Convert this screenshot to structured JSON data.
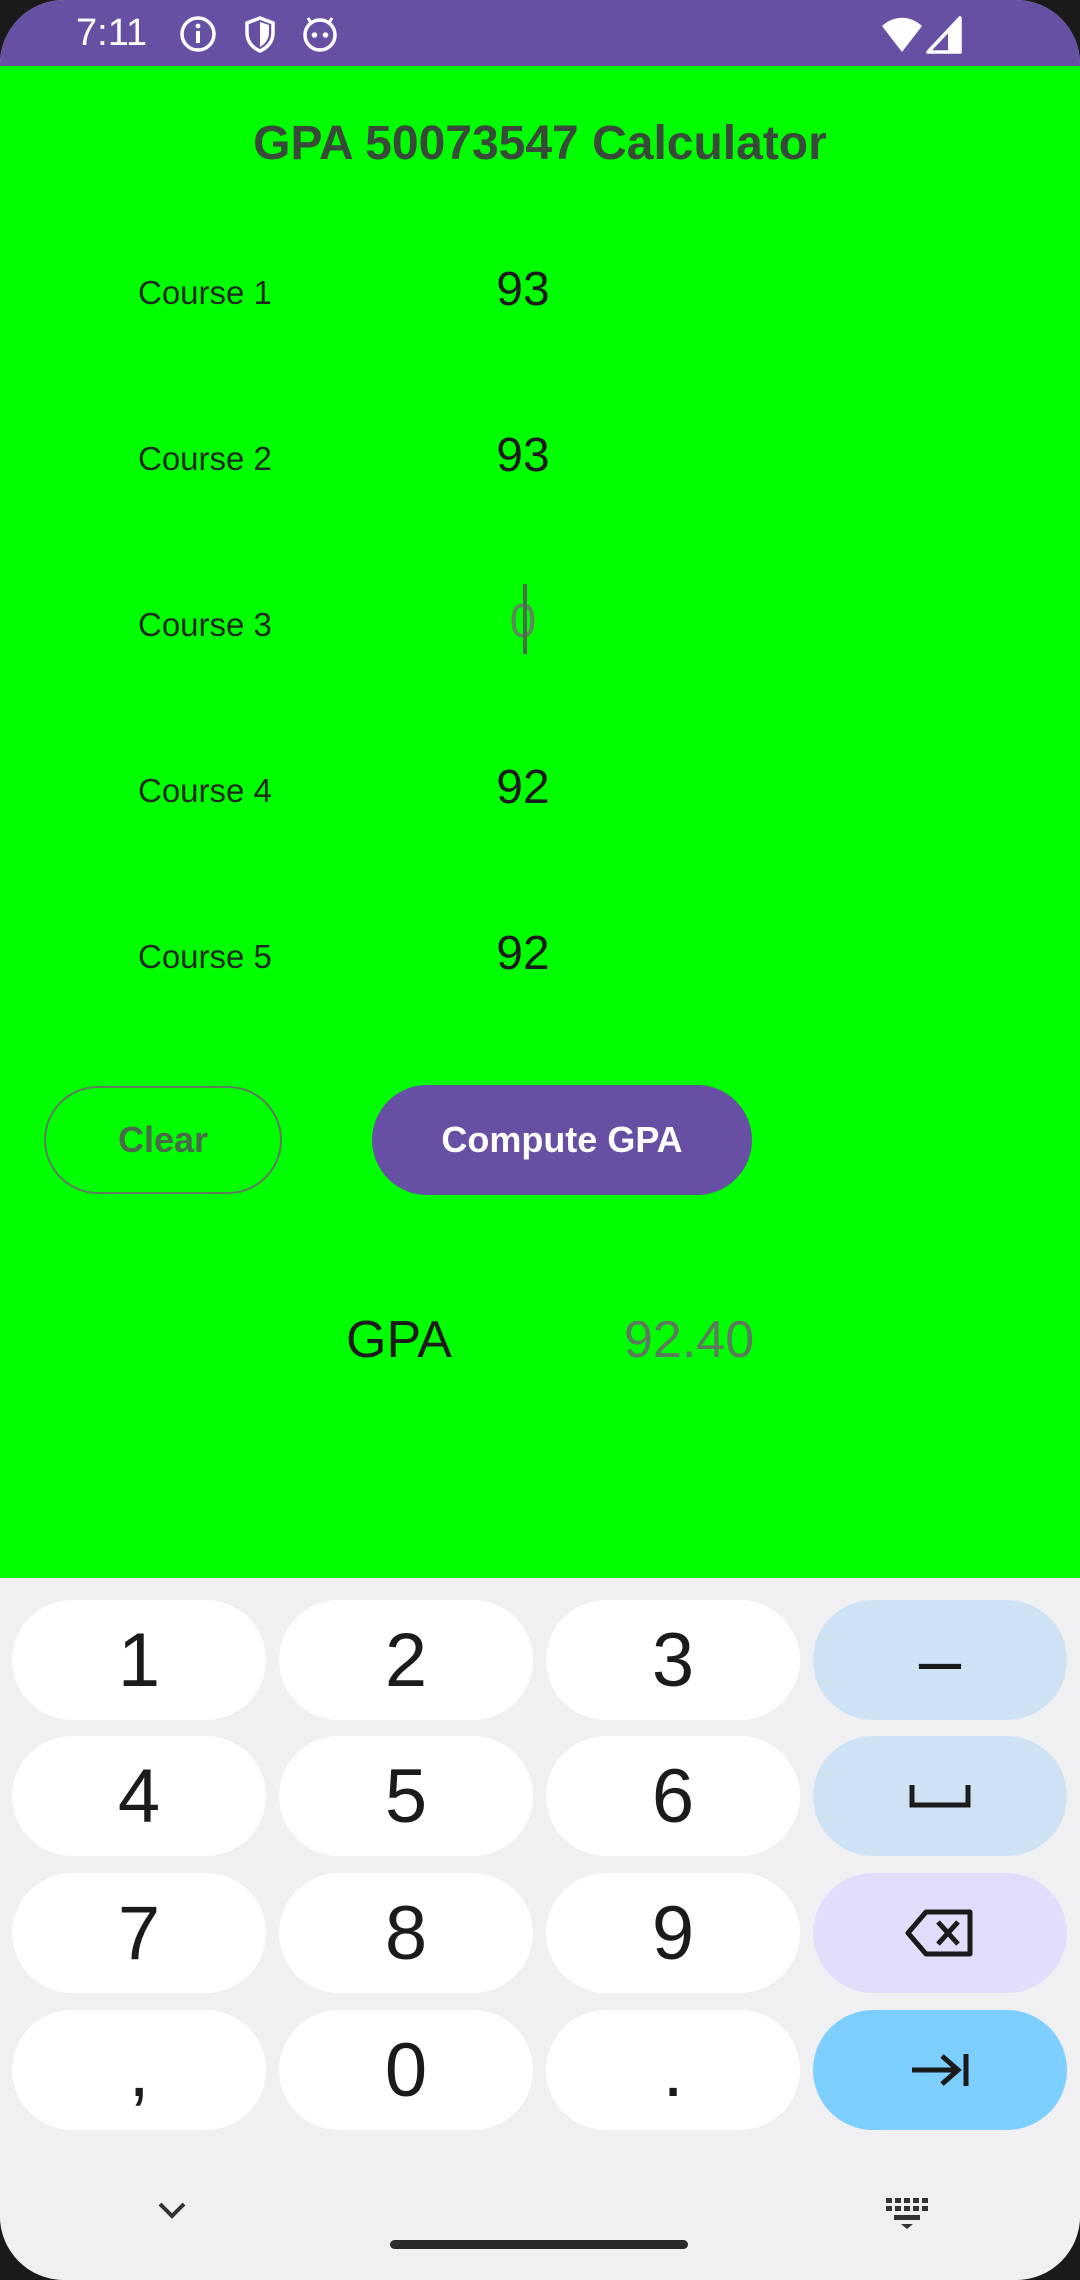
{
  "status_bar": {
    "time": "7:11",
    "left_icons": [
      "info-icon",
      "shield-icon",
      "android-face-icon"
    ],
    "right_icons": [
      "wifi-icon",
      "signal-icon"
    ],
    "background": "#6750a4"
  },
  "app": {
    "background": "#00ff00",
    "title": "GPA 50073547 Calculator",
    "courses": [
      {
        "label": "Course 1",
        "value": "93"
      },
      {
        "label": "Course 2",
        "value": "93"
      },
      {
        "label": "Course 3",
        "value": "",
        "placeholder": "0",
        "focused": true
      },
      {
        "label": "Course 4",
        "value": "92"
      },
      {
        "label": "Course 5",
        "value": "92"
      }
    ],
    "clear_button": "Clear",
    "compute_button": "Compute GPA",
    "gpa_label": "GPA",
    "gpa_value": "92.40",
    "accent": "#6750a4"
  },
  "keyboard": {
    "rows": [
      [
        "1",
        "2",
        "3",
        "–"
      ],
      [
        "4",
        "5",
        "6",
        "space"
      ],
      [
        "7",
        "8",
        "9",
        "backspace"
      ],
      [
        ",",
        "0",
        ".",
        "enter"
      ]
    ],
    "key_1": "1",
    "key_2": "2",
    "key_3": "3",
    "key_minus": "–",
    "key_4": "4",
    "key_5": "5",
    "key_6": "6",
    "key_7": "7",
    "key_8": "8",
    "key_9": "9",
    "key_comma": ",",
    "key_0": "0",
    "key_period": ".",
    "action_icons": [
      "space-icon",
      "backspace-icon",
      "tab-next-icon"
    ],
    "nav_icons": [
      "chevron-down-icon",
      "keyboard-icon"
    ]
  }
}
